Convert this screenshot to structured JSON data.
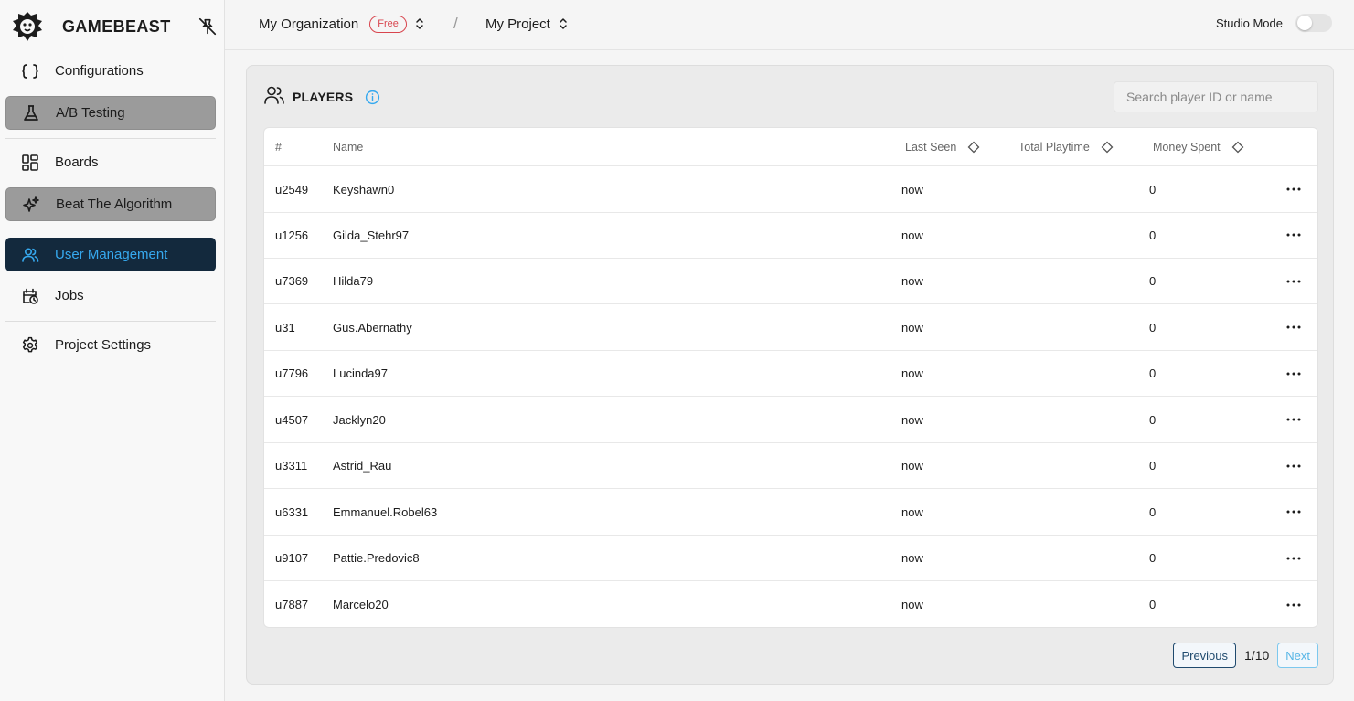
{
  "brand": {
    "name": "GAMEBEAST",
    "logo_icon": "lion-icon",
    "pin_icon": "unpin-icon"
  },
  "sidebar": {
    "items": [
      {
        "label": "Configurations",
        "icon": "braces-icon",
        "state": "normal"
      },
      {
        "label": "A/B Testing",
        "icon": "flask-icon",
        "state": "gray"
      },
      {
        "label": "Boards",
        "icon": "dashboard-icon",
        "state": "normal"
      },
      {
        "label": "Beat The Algorithm",
        "icon": "sparkles-icon",
        "state": "gray"
      },
      {
        "label": "User Management",
        "icon": "users-icon",
        "state": "active"
      },
      {
        "label": "Jobs",
        "icon": "calendar-clock-icon",
        "state": "normal"
      },
      {
        "label": "Project Settings",
        "icon": "gear-icon",
        "state": "normal"
      }
    ]
  },
  "topbar": {
    "organization": "My Organization",
    "plan_badge": "Free",
    "separator": "/",
    "project": "My Project",
    "studio_mode_label": "Studio Mode",
    "studio_mode_on": false
  },
  "players": {
    "title": "PLAYERS",
    "search_placeholder": "Search player ID or name",
    "columns": {
      "id": "#",
      "name": "Name",
      "last_seen": "Last Seen",
      "playtime": "Total Playtime",
      "money": "Money Spent"
    },
    "rows": [
      {
        "id": "u2549",
        "name": "Keyshawn0",
        "last_seen": "now",
        "money": "0"
      },
      {
        "id": "u1256",
        "name": "Gilda_Stehr97",
        "last_seen": "now",
        "money": "0"
      },
      {
        "id": "u7369",
        "name": "Hilda79",
        "last_seen": "now",
        "money": "0"
      },
      {
        "id": "u31",
        "name": "Gus.Abernathy",
        "last_seen": "now",
        "money": "0"
      },
      {
        "id": "u7796",
        "name": "Lucinda97",
        "last_seen": "now",
        "money": "0"
      },
      {
        "id": "u4507",
        "name": "Jacklyn20",
        "last_seen": "now",
        "money": "0"
      },
      {
        "id": "u3311",
        "name": "Astrid_Rau",
        "last_seen": "now",
        "money": "0"
      },
      {
        "id": "u6331",
        "name": "Emmanuel.Robel63",
        "last_seen": "now",
        "money": "0"
      },
      {
        "id": "u9107",
        "name": "Pattie.Predovic8",
        "last_seen": "now",
        "money": "0"
      },
      {
        "id": "u7887",
        "name": "Marcelo20",
        "last_seen": "now",
        "money": "0"
      }
    ],
    "pagination": {
      "previous": "Previous",
      "page": "1/10",
      "next": "Next"
    }
  },
  "colors": {
    "active_bg": "#13293d",
    "active_text": "#36a9ef",
    "badge": "#d8454e",
    "info": "#36a9ef"
  }
}
